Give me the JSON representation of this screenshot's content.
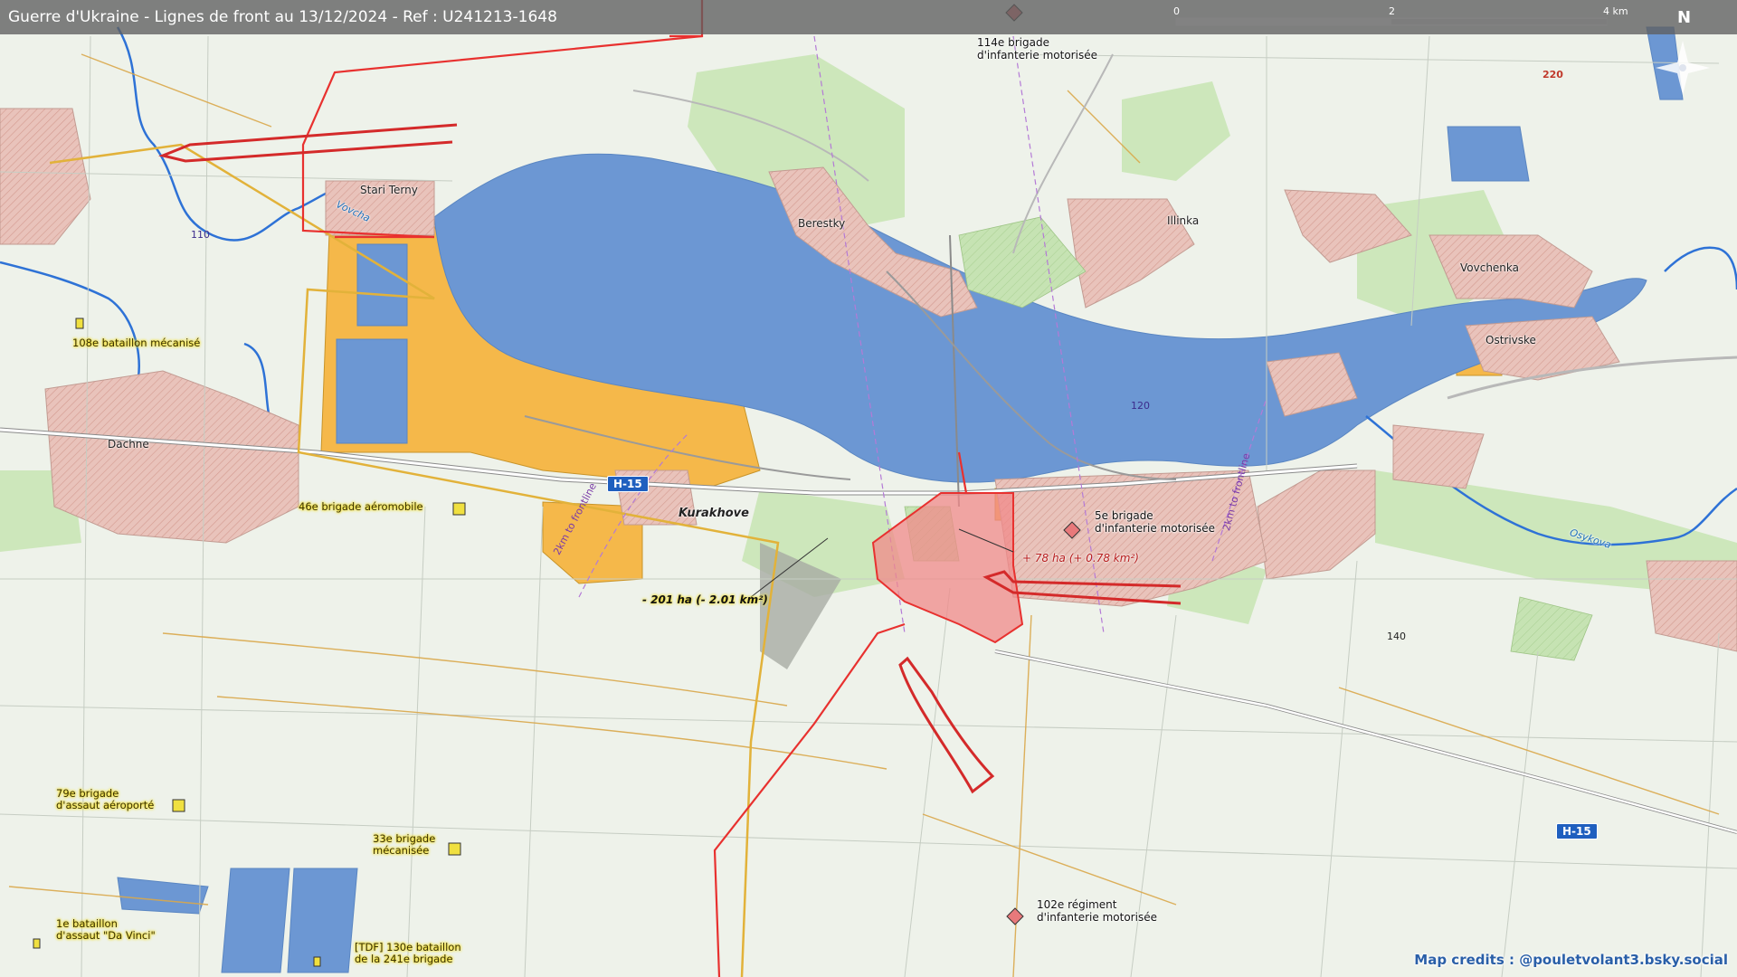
{
  "title": "Guerre d'Ukraine - Lignes de front au 13/12/2024 - Ref : U241213-1648",
  "credits": "Map credits : @pouletvolant3.bsky.social",
  "scale": {
    "t0": "0",
    "t2": "2",
    "t4": "4 km"
  },
  "north": "N",
  "places": {
    "stari_terny": "Stari Terny",
    "berestky": "Berestky",
    "illinka": "Illinka",
    "vovchenka": "Vovchenka",
    "ostrivske": "Ostrivske",
    "dachne": "Dachne",
    "kurakhove": "Kurakhove"
  },
  "rivers": {
    "vovcha": "Vovcha",
    "osykova": "Osykova"
  },
  "roads": {
    "h15_a": "H-15",
    "h15_b": "H-15"
  },
  "numbers": {
    "n110": "110",
    "n120": "120",
    "n140": "140",
    "n220": "220"
  },
  "buffer": {
    "west": "2km to frontline",
    "east": "2km to frontline"
  },
  "areas": {
    "gain": "+ 78 ha (+ 0.78 km²)",
    "loss": "- 201 ha (- 2.01 km²)"
  },
  "units": {
    "u114": [
      "114e brigade",
      "d'infanterie motorisée"
    ],
    "u5": [
      "5e brigade",
      "d'infanterie motorisée"
    ],
    "u102": [
      "102e régiment",
      "d'infanterie motorisée"
    ],
    "u108": [
      "108e bataillon mécanisé"
    ],
    "u46": [
      "46e brigade aéromobile"
    ],
    "u79": [
      "79e brigade",
      "d'assaut aéroporté"
    ],
    "u33": [
      "33e brigade",
      "mécanisée"
    ],
    "u1": [
      "1e bataillon",
      "d'assaut \"Da Vinci\""
    ],
    "utdf": [
      "[TDF] 130e bataillon",
      "de la 241e brigade"
    ]
  },
  "colors": {
    "water": "#6c97d3",
    "russian_control": "#e23a3a",
    "ukrainian_unit": "#f0e040",
    "frontline": "#e8312f",
    "ukr_line": "#e2b23a",
    "orange_zone": "#f5b84a",
    "urban": "#e9c3bb"
  }
}
